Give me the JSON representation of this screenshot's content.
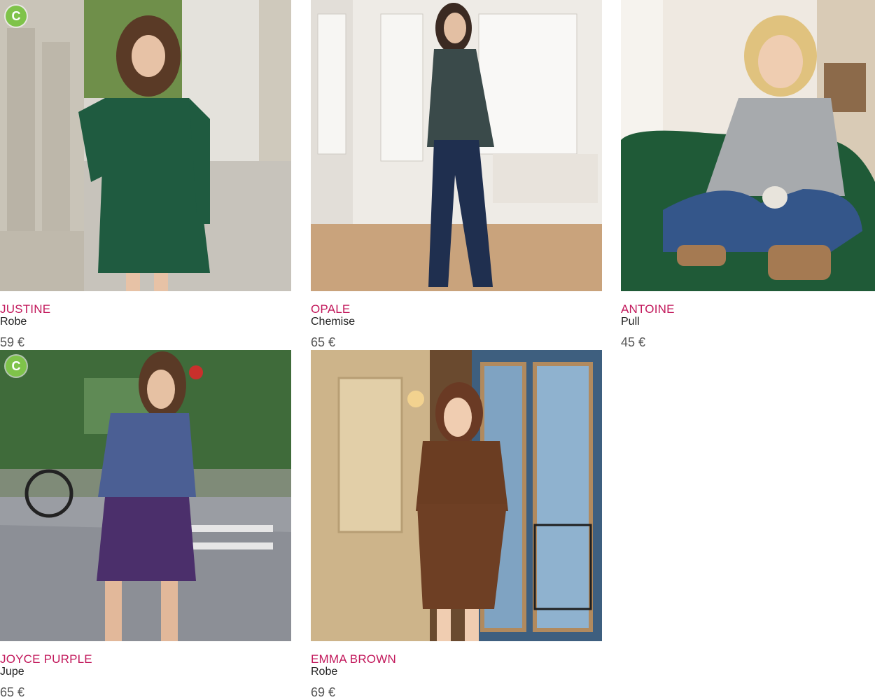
{
  "colors": {
    "accent": "#c2185b",
    "text": "#1f1f1f",
    "price": "#555555",
    "badge": "#7fc34a"
  },
  "badge_glyph": "C",
  "products": [
    {
      "name": "JUSTINE",
      "type": "Robe",
      "price": "59 €",
      "has_badge": true
    },
    {
      "name": "OPALE",
      "type": "Chemise",
      "price": "65 €",
      "has_badge": false
    },
    {
      "name": "ANTOINE",
      "type": "Pull",
      "price": "45 €",
      "has_badge": false
    },
    {
      "name": "JOYCE PURPLE",
      "type": "Jupe",
      "price": "65 €",
      "has_badge": true
    },
    {
      "name": "EMMA BROWN",
      "type": "Robe",
      "price": "69 €",
      "has_badge": false
    }
  ]
}
